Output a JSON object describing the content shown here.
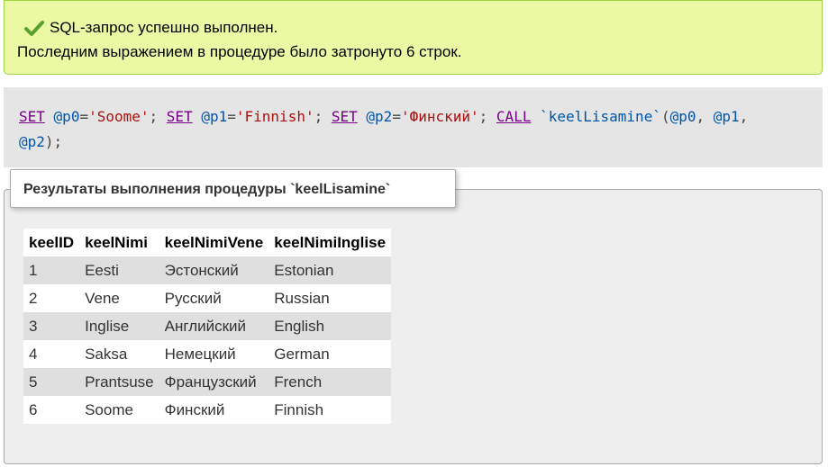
{
  "message": {
    "line1": "SQL-запрос успешно выполнен.",
    "line2": "Последним выражением в процедуре было затронуто 6 строк.",
    "icon": "check-icon",
    "color_bg": "#ebf8a4",
    "color_border": "#a2d246"
  },
  "sql": {
    "kw_set": "SET",
    "kw_call": "CALL",
    "p0": "@p0",
    "p1": "@p1",
    "p2": "@p2",
    "v0": "'Soome'",
    "v1": "'Finnish'",
    "v2": "'Финский'",
    "proc": "`keelLisamine`"
  },
  "results": {
    "legend": "Результаты выполнения процедуры `keelLisamine`",
    "columns": [
      "keelID",
      "keelNimi",
      "keelNimiVene",
      "keelNimiInglise"
    ],
    "rows": [
      [
        "1",
        "Eesti",
        "Эстонский",
        "Estonian"
      ],
      [
        "2",
        "Vene",
        "Русский",
        "Russian"
      ],
      [
        "3",
        "Inglise",
        "Английский",
        "English"
      ],
      [
        "4",
        "Saksa",
        "Немецкий",
        "German"
      ],
      [
        "5",
        "Prantsuse",
        "Французский",
        "French"
      ],
      [
        "6",
        "Soome",
        "Финский",
        "Finnish"
      ]
    ]
  }
}
